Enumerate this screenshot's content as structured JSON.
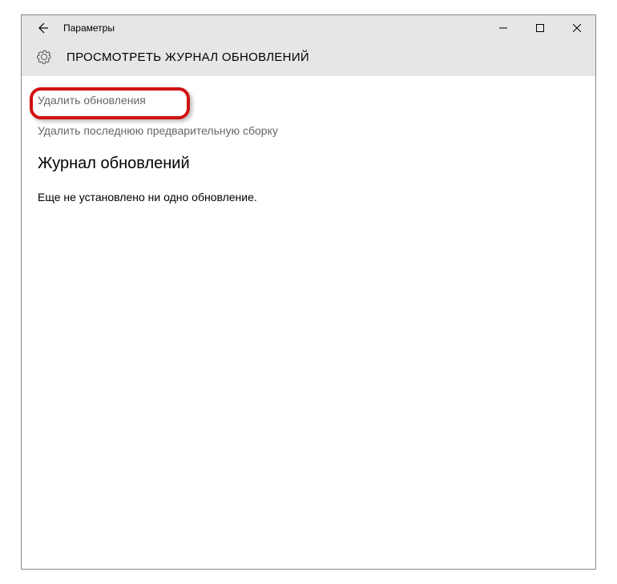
{
  "titlebar": {
    "title": "Параметры"
  },
  "header": {
    "heading": "ПРОСМОТРЕТЬ ЖУРНАЛ ОБНОВЛЕНИЙ"
  },
  "content": {
    "link_uninstall": "Удалить обновления",
    "link_remove_build": "Удалить последнюю предварительную сборку",
    "section_heading": "Журнал обновлений",
    "empty_text": "Еще не установлено ни одно обновление."
  }
}
